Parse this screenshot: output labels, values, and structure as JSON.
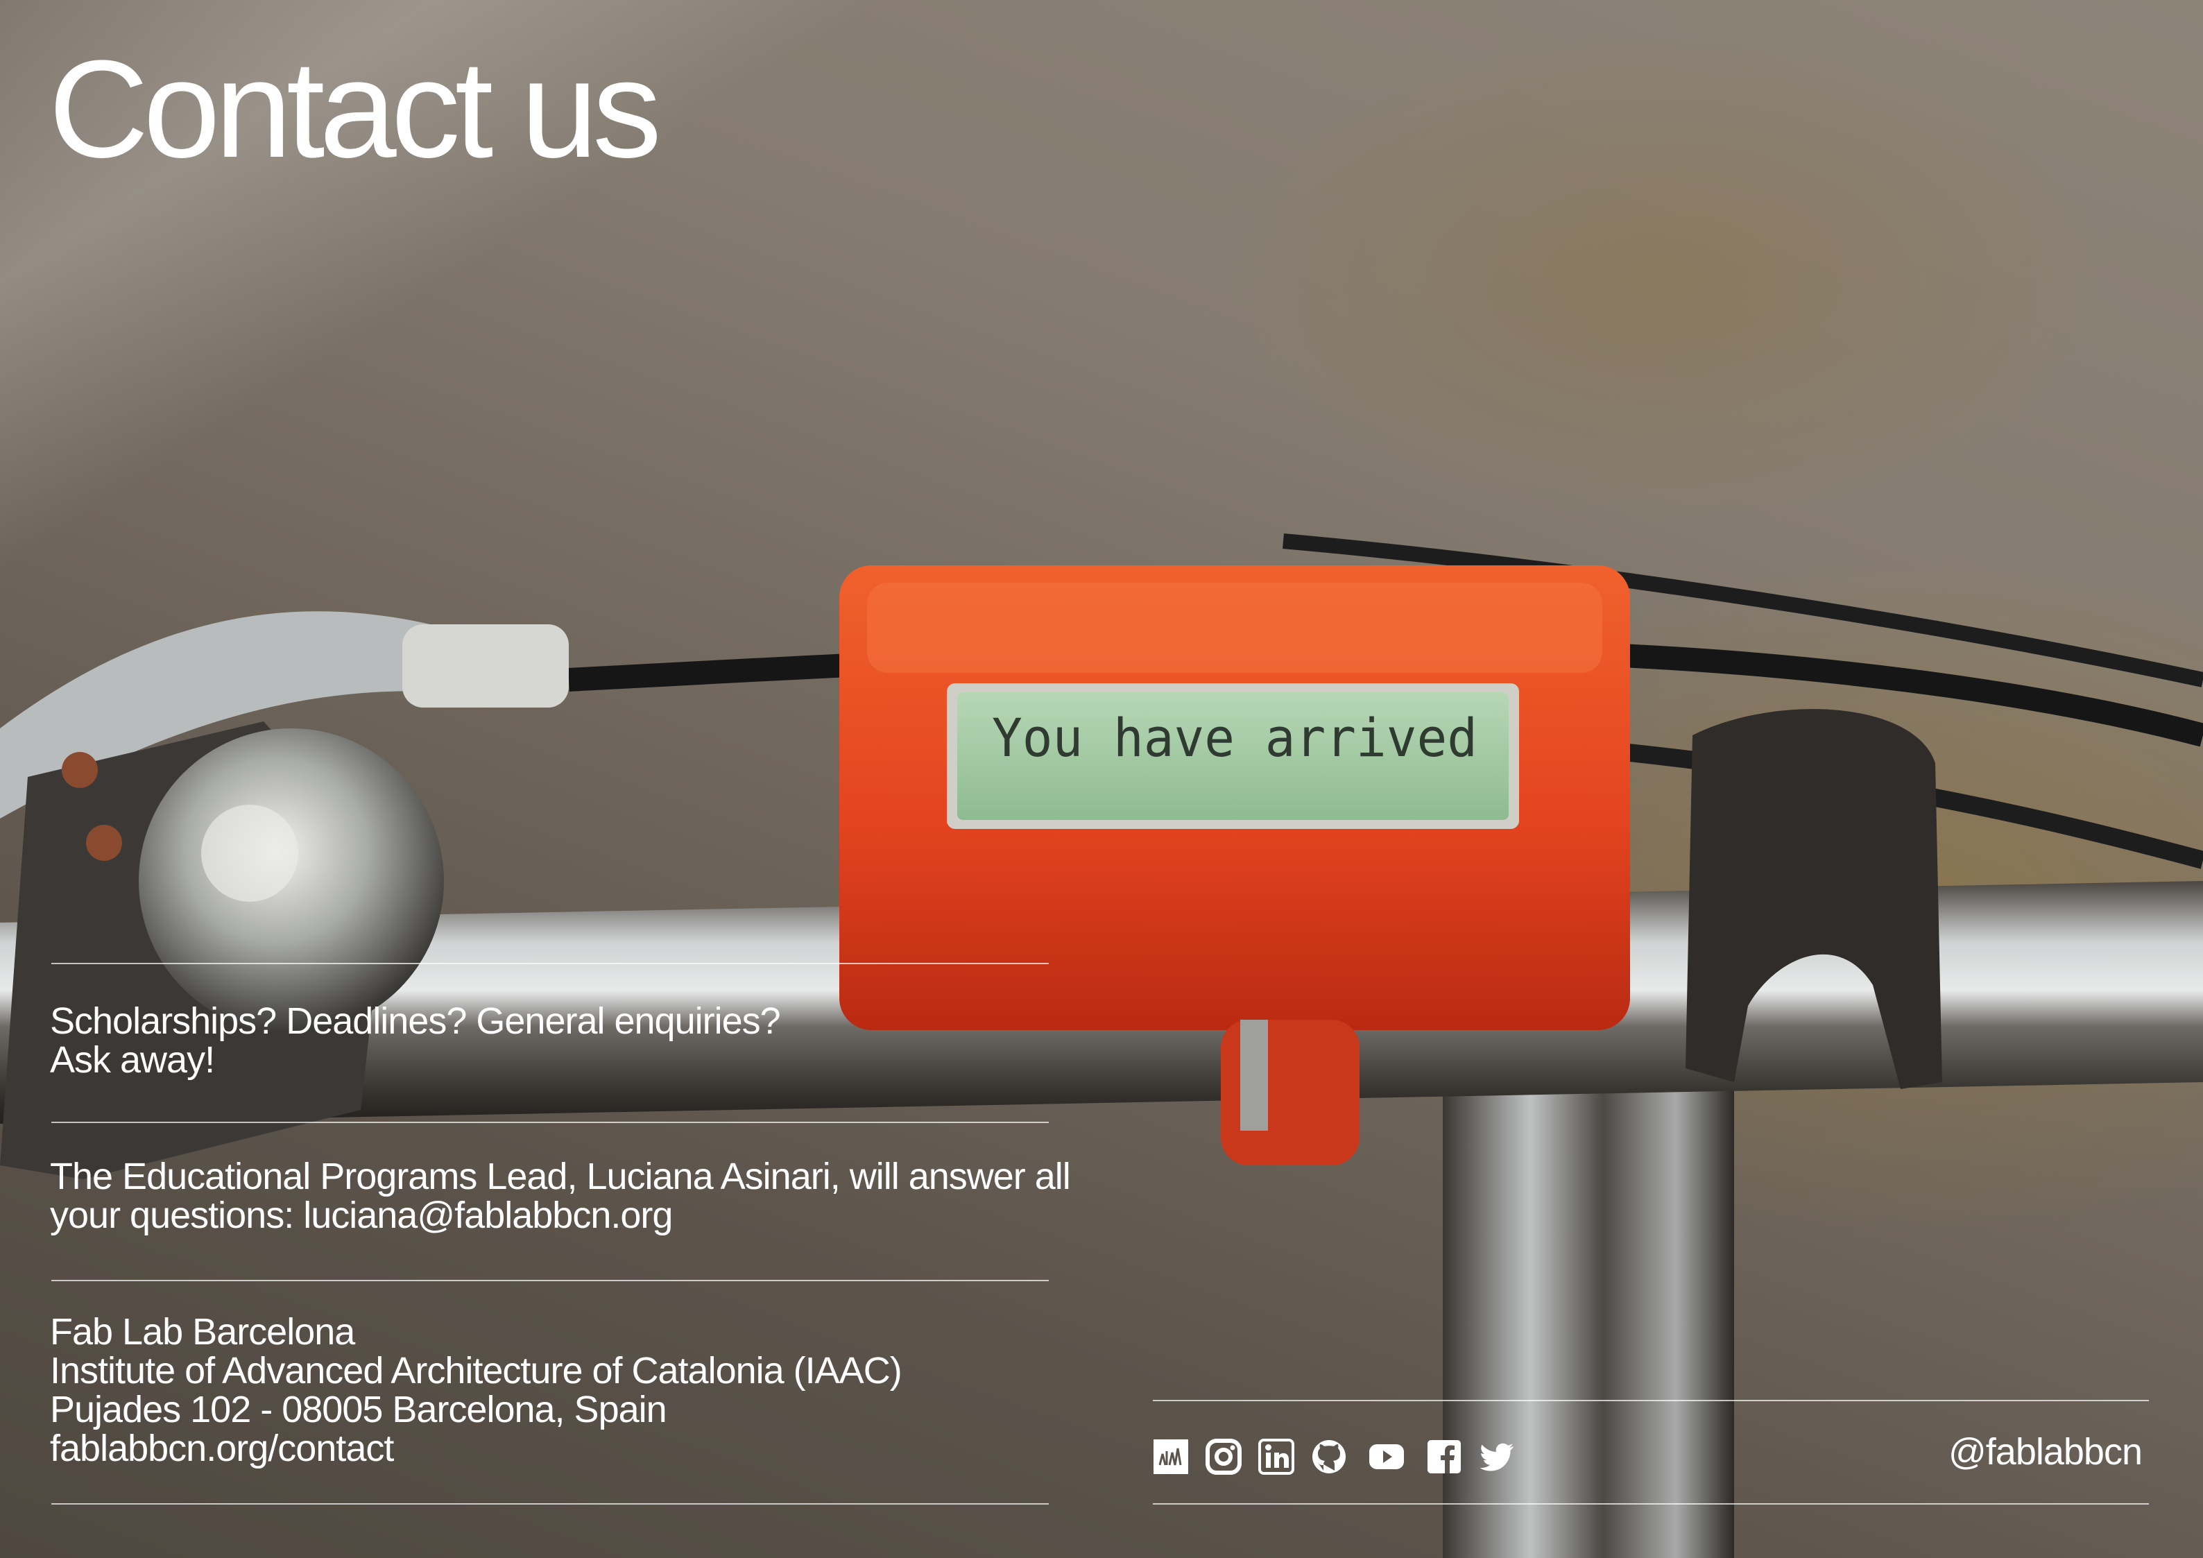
{
  "title": "Contact us",
  "lcd_text": "You have arrived",
  "blocks": {
    "enquiries": [
      "Scholarships? Deadlines? General enquiries?",
      "Ask away!"
    ],
    "lead": [
      "The Educational Programs Lead, Luciana Asinari, will answer all",
      "your questions: luciana@fablabbcn.org"
    ],
    "address": [
      "Fab Lab Barcelona",
      "Institute of Advanced Architecture of Catalonia (IAAC)",
      "Pujades 102 - 08005 Barcelona, Spain",
      "fablabbcn.org/contact"
    ]
  },
  "social": {
    "icons": [
      "blog-icon",
      "instagram-icon",
      "linkedin-icon",
      "github-icon",
      "youtube-icon",
      "facebook-icon",
      "twitter-icon"
    ],
    "handle": "@fablabbcn"
  },
  "colors": {
    "text": "#ffffff",
    "device": "#e2431f",
    "lcd": "#9fc6a0"
  }
}
